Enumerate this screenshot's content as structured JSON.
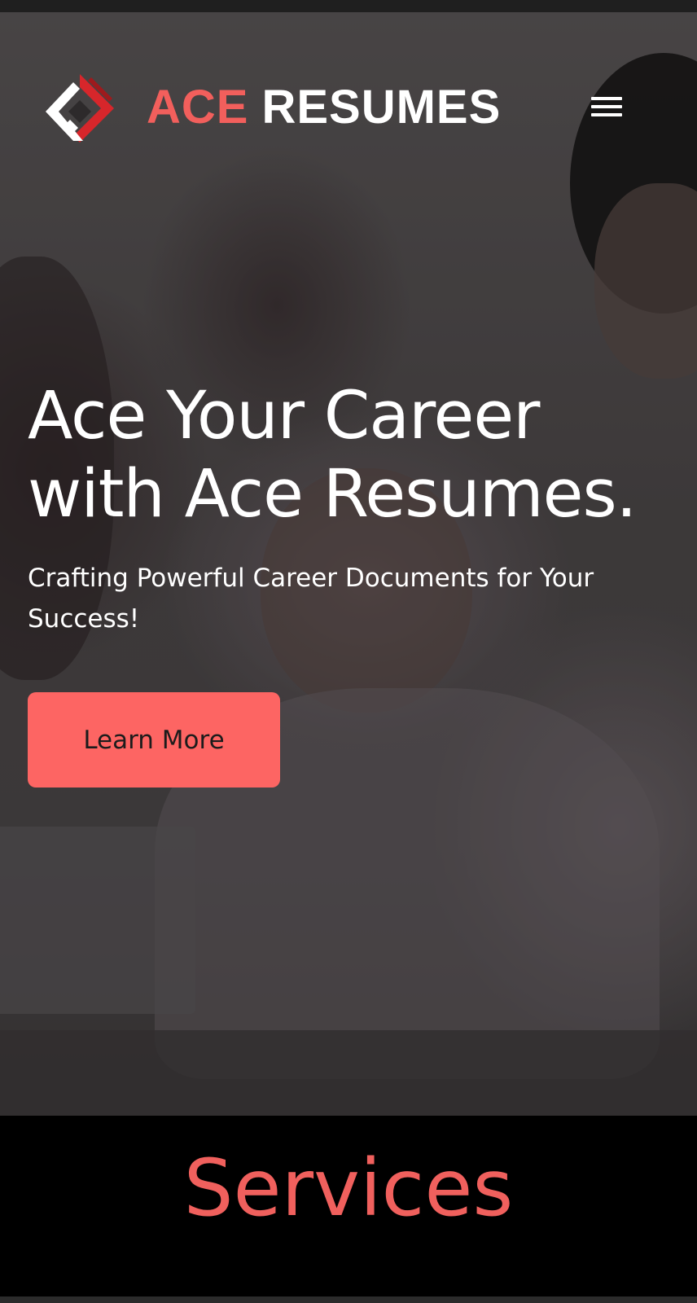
{
  "brand": {
    "name_part1": "ACE",
    "name_part2": "RESUMES",
    "logo_icon": "ace-resumes-logo-icon",
    "accent_color": "#f25f5c"
  },
  "nav": {
    "menu_icon": "hamburger-menu-icon"
  },
  "hero": {
    "headline": "Ace Your Career with Ace Resumes.",
    "subheadline": "Crafting Powerful Career Documents for Your Success!",
    "cta_label": "Learn More",
    "cta_color": "#fd6563",
    "background_image": "team-working-at-laptop-photo"
  },
  "services": {
    "title": "Services",
    "title_color": "#f0605d"
  }
}
